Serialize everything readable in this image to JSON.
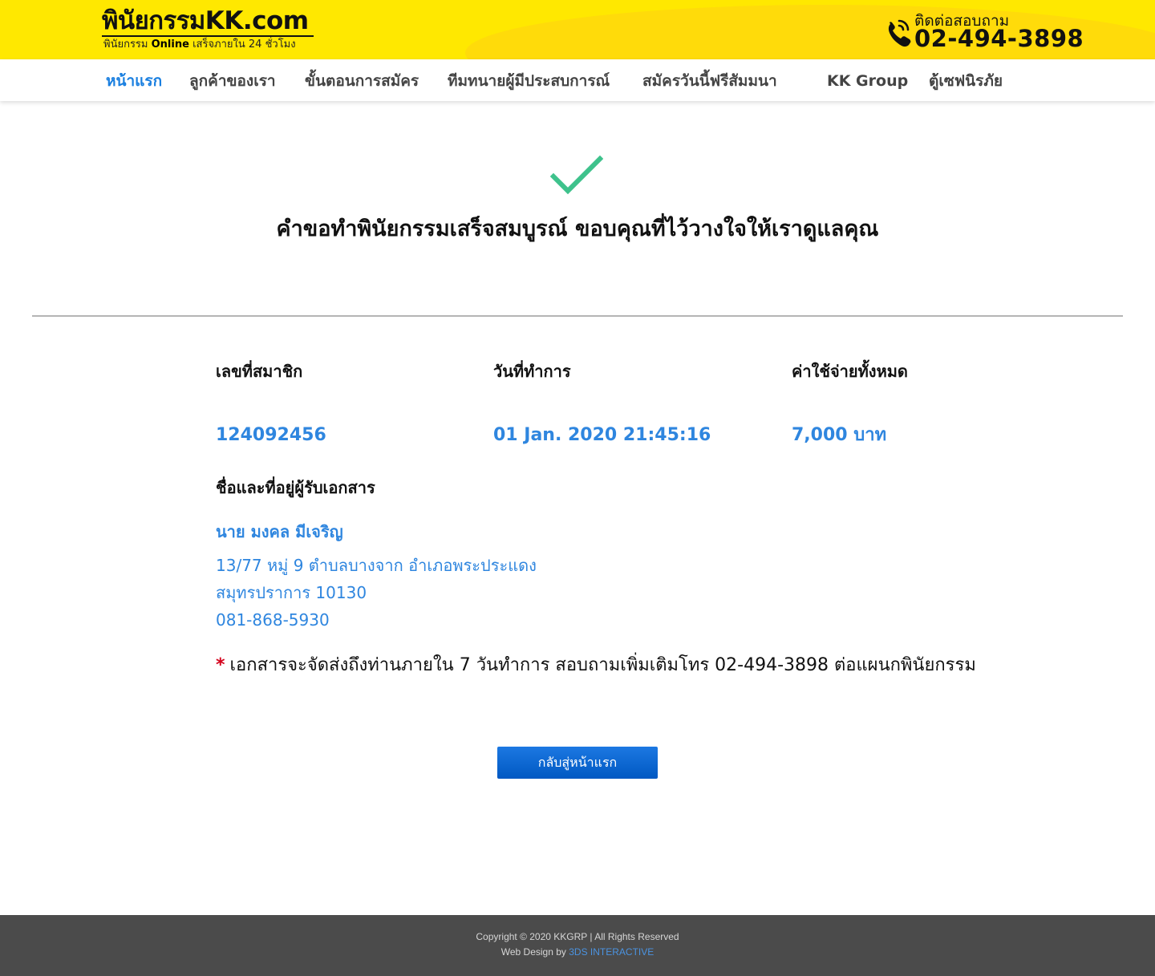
{
  "header": {
    "logo_text": "พินัยกรรมKK.com",
    "logo_tagline_prefix": "พินัยกรรม",
    "logo_tagline_bold": "Online",
    "logo_tagline_suffix": "เสร็จภายใน 24 ชั่วโมง",
    "contact_label": "ติดต่อสอบถาม",
    "contact_phone": "02-494-3898"
  },
  "nav": {
    "items": [
      {
        "label": "หน้าแรก",
        "active": true
      },
      {
        "label": "ลูกค้าของเรา"
      },
      {
        "label": "ขั้นตอนการสมัคร"
      },
      {
        "label": "ทีมทนายผู้มีประสบการณ์"
      },
      {
        "label": "สมัครวันนี้ฟรีสัมมนา"
      },
      {
        "label": "KK Group"
      },
      {
        "label": "ตู้เซฟนิรภัย"
      }
    ]
  },
  "success": {
    "icon": "check-icon",
    "message": "คำขอทำพินัยกรรมเสร็จสมบูรณ์ ขอบคุณที่ไว้วางใจให้เราดูแลคุณ"
  },
  "details": {
    "member_id_label": "เลขที่สมาชิก",
    "member_id": "124092456",
    "date_label": "วันที่ทำการ",
    "date": "01 Jan. 2020 21:45:16",
    "cost_label": "ค่าใช้จ่ายทั้งหมด",
    "cost": "7,000 บาท",
    "recipient_label": "ชื่อและที่อยู่ผู้รับเอกสาร",
    "recipient_name": "นาย มงคล มีเจริญ",
    "address_line1": "13/77 หมู่ 9 ตำบลบางจาก อำเภอพระประแดง",
    "address_line2": "สมุทรปราการ 10130",
    "phone": "081-868-5930"
  },
  "note": {
    "star": "*",
    "text": "เอกสารจะจัดส่งถึงท่านภายใน 7 วันทำการ สอบถามเพิ่มเติมโทร 02-494-3898 ต่อแผนกพินัยกรรม"
  },
  "back_button_label": "กลับสู่หน้าแรก",
  "footer": {
    "copyright": "Copyright © 2020 KKGRP | All Rights Reserved",
    "design_prefix": "Web Design by",
    "design_link": "3DS INTERACTIVE"
  },
  "colors": {
    "header_yellow": "#ffe800",
    "accent_blue": "#2f86df",
    "check_green": "#3ec28c",
    "footer_bg": "#4b4b4b",
    "required_red": "#d4001b"
  }
}
